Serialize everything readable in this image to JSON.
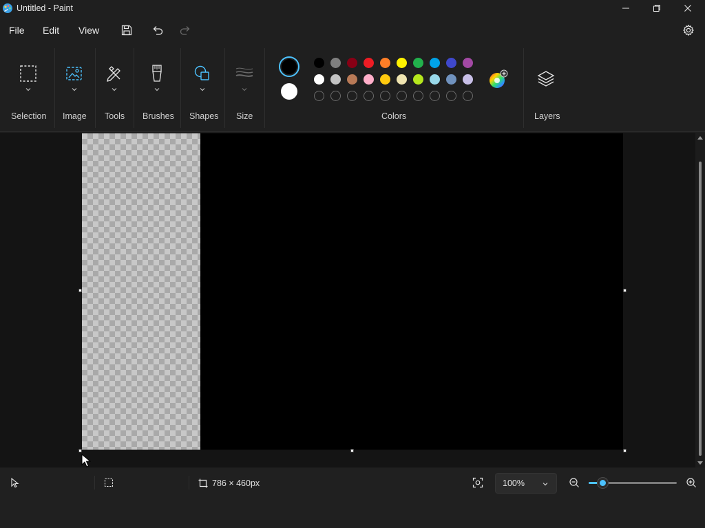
{
  "window": {
    "title": "Untitled - Paint"
  },
  "menu": {
    "file": "File",
    "edit": "Edit",
    "view": "View"
  },
  "ribbon": {
    "groups": {
      "selection": "Selection",
      "image": "Image",
      "tools": "Tools",
      "brushes": "Brushes",
      "shapes": "Shapes",
      "size": "Size",
      "colors": "Colors",
      "layers": "Layers"
    },
    "primary_color": "#000000",
    "secondary_color": "#ffffff",
    "palette": [
      [
        "#000000",
        "#7f7f7f",
        "#880015",
        "#ed1c24",
        "#ff7f27",
        "#fff200",
        "#22b14c",
        "#00a2e8",
        "#3f48cc",
        "#a349a4"
      ],
      [
        "#ffffff",
        "#c3c3c3",
        "#b97a57",
        "#ffaec9",
        "#ffc90e",
        "#efe4b0",
        "#b5e61d",
        "#99d9ea",
        "#7092be",
        "#c8bfe7"
      ],
      [
        "",
        "",
        "",
        "",
        "",
        "",
        "",
        "",
        "",
        ""
      ]
    ]
  },
  "status": {
    "canvas_size": "786 × 460px",
    "zoom": "100%",
    "zoom_slider_fraction": 0.16
  },
  "colors": {
    "accent": "#4cc2ff"
  }
}
